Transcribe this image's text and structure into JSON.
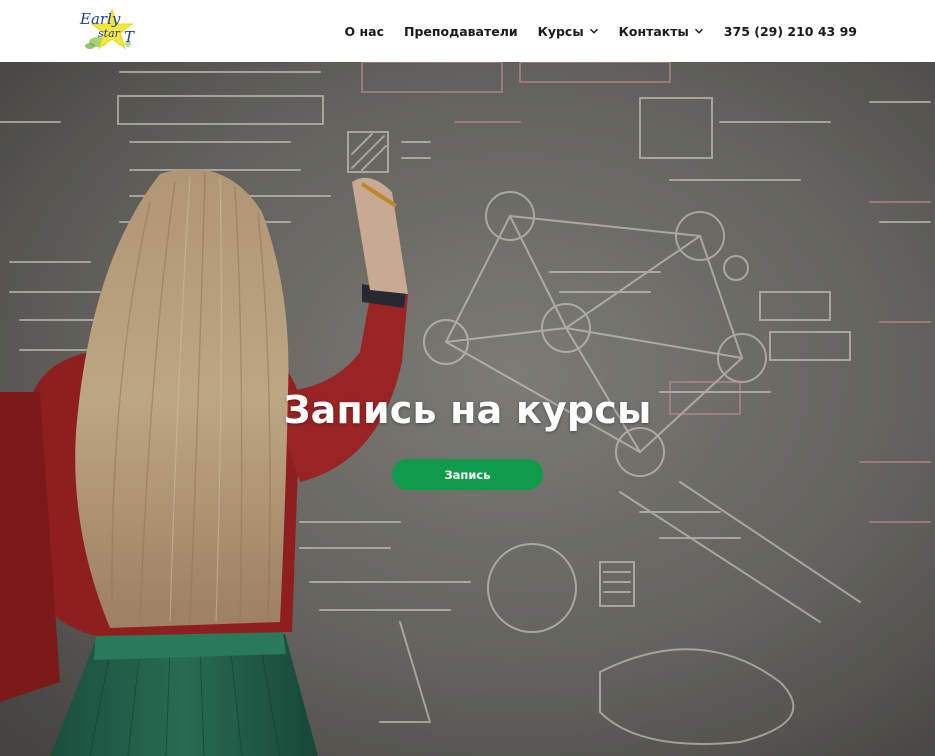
{
  "logo": {
    "line1": "Early",
    "line2": "star",
    "line3": "T",
    "icon": "star-logo-icon"
  },
  "nav": {
    "about": "О нас",
    "teachers": "Преподаватели",
    "courses": "Курсы",
    "contacts": "Контакты",
    "phone": "375 (29) 210 43 99",
    "dropdown_icon": "chevron-down-icon"
  },
  "hero": {
    "title": "Запись на курсы",
    "button_label": "Запись",
    "image": "woman-writing-on-chalkboard-photo"
  },
  "colors": {
    "accent": "#109b4c",
    "nav_text": "#1a1a1a",
    "logo_blue": "#1d3f8f",
    "logo_yellow": "#f5e83a"
  }
}
